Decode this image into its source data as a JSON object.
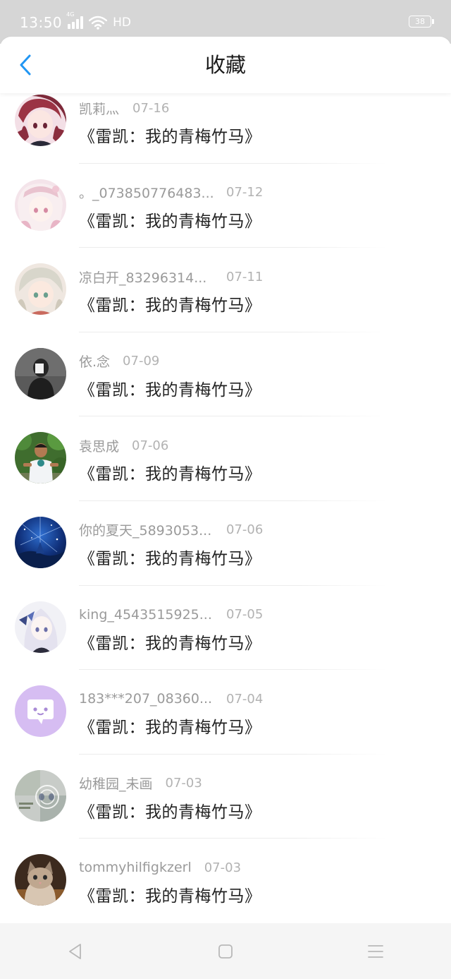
{
  "status_bar": {
    "time": "13:50",
    "network": "4G",
    "hd": "HD",
    "battery": "38"
  },
  "header": {
    "title": "收藏",
    "back_icon": "chevron-left-icon",
    "accent_color": "#2196f3"
  },
  "items": [
    {
      "username": "凯莉灬",
      "date": "07-16",
      "book": "《雷凯：我的青梅竹马》",
      "avatar": "anime-girl-red-hair"
    },
    {
      "username": "。_073850776483...",
      "date": "07-12",
      "book": "《雷凯：我的青梅竹马》",
      "avatar": "anime-girl-pink"
    },
    {
      "username": "凉白开_83296314...",
      "date": "07-11",
      "book": "《雷凯：我的青梅竹马》",
      "avatar": "anime-girl-white-hair"
    },
    {
      "username": "依.念",
      "date": "07-09",
      "book": "《雷凯：我的青梅竹马》",
      "avatar": "dark-figure"
    },
    {
      "username": "袁思成",
      "date": "07-06",
      "book": "《雷凯：我的青梅竹马》",
      "avatar": "child-photo"
    },
    {
      "username": "你的夏天_5893053...",
      "date": "07-06",
      "book": "《雷凯：我的青梅竹马》",
      "avatar": "starry-night"
    },
    {
      "username": "king_4543515925...",
      "date": "07-05",
      "book": "《雷凯：我的青梅竹马》",
      "avatar": "anime-girl-butterfly"
    },
    {
      "username": "183***207_08360...",
      "date": "07-04",
      "book": "《雷凯：我的青梅竹马》",
      "avatar": "default-chat-avatar"
    },
    {
      "username": "幼稚园_未画",
      "date": "07-03",
      "book": "《雷凯：我的青梅竹马》",
      "avatar": "blurred-collage"
    },
    {
      "username": "tommyhilfigkzerl",
      "date": "07-03",
      "book": "《雷凯：我的青梅竹马》",
      "avatar": "kitten-photo"
    }
  ],
  "nav_bar": {
    "back_icon": "triangle-back-icon",
    "home_icon": "square-home-icon",
    "menu_icon": "lines-menu-icon"
  }
}
